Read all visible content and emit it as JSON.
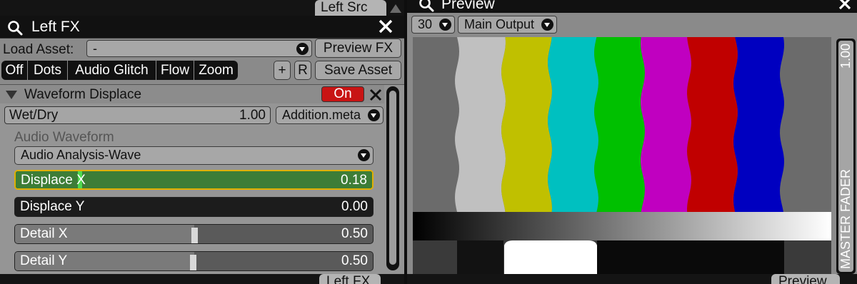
{
  "left_panel": {
    "top_tab": "Left Src",
    "title": "Left FX",
    "load_asset_label": "Load Asset:",
    "load_asset_value": "-",
    "preview_fx_label": "Preview FX",
    "fx_tabs": [
      "Off",
      "Dots",
      "Audio Glitch",
      "Flow",
      "Zoom"
    ],
    "add_label": "+",
    "r_label": "R",
    "save_asset_label": "Save Asset",
    "effect": {
      "name": "Waveform Displace",
      "enabled_label": "On",
      "wet_dry_label": "Wet/Dry",
      "wet_dry_value": "1.00",
      "blend_mode": "Addition.meta",
      "audio_section_label": "Audio Waveform",
      "audio_source": "Audio Analysis-Wave",
      "params": [
        {
          "name": "Displace X",
          "value": "0.18",
          "level": 0.18
        },
        {
          "name": "Displace Y",
          "value": "0.00",
          "level": 0.0
        },
        {
          "name": "Detail X",
          "value": "0.50",
          "level": 0.5
        },
        {
          "name": "Detail Y",
          "value": "0.50",
          "level": 0.5
        }
      ]
    },
    "bottom_tab": "Left FX"
  },
  "right_panel": {
    "title": "Preview",
    "fps_value": "30",
    "output_value": "Main Output",
    "fader_value": "1.00",
    "fader_label": "MASTER FADER",
    "bottom_tab": "Preview"
  },
  "colors": {
    "on_red": "#c81414",
    "active_green": "#3d7d37",
    "highlight_yellow": "#e0b000",
    "bars": [
      "#c0c0c0",
      "#c0c000",
      "#00c0c0",
      "#00c000",
      "#c000c0",
      "#c00000",
      "#0000c0"
    ]
  },
  "icons": [
    "search-icon",
    "close-icon",
    "chevron-down-icon",
    "collapse-triangle-icon"
  ]
}
